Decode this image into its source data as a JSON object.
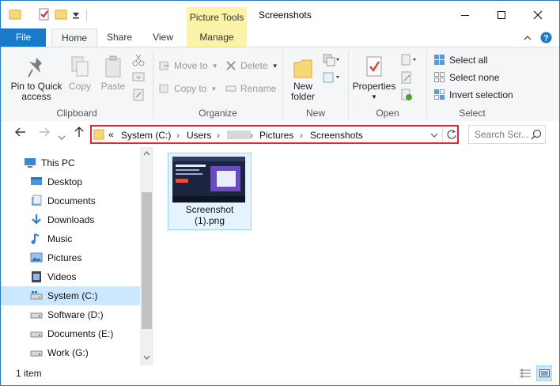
{
  "title_bar": {
    "contextual_tab_group": "Picture Tools",
    "window_title": "Screenshots"
  },
  "tabs": [
    {
      "label": "File"
    },
    {
      "label": "Home"
    },
    {
      "label": "Share"
    },
    {
      "label": "View"
    },
    {
      "label": "Manage"
    }
  ],
  "ribbon": {
    "clipboard": {
      "pin_label_1": "Pin to Quick",
      "pin_label_2": "access",
      "copy": "Copy",
      "paste": "Paste",
      "group": "Clipboard"
    },
    "organize": {
      "move_to": "Move to",
      "copy_to": "Copy to",
      "delete": "Delete",
      "rename": "Rename",
      "group": "Organize"
    },
    "new": {
      "new_folder_1": "New",
      "new_folder_2": "folder",
      "group": "New"
    },
    "open": {
      "properties": "Properties",
      "group": "Open"
    },
    "select": {
      "select_all": "Select all",
      "select_none": "Select none",
      "invert": "Invert selection",
      "group": "Select"
    }
  },
  "address": {
    "overflow": "«",
    "segments": [
      "System (C:)",
      "Users",
      "Pictures",
      "Screenshots"
    ],
    "search_placeholder": "Search Scr..."
  },
  "nav_pane": {
    "items": [
      {
        "label": "This PC",
        "icon": "pc-icon"
      },
      {
        "label": "Desktop",
        "icon": "desktop-icon"
      },
      {
        "label": "Documents",
        "icon": "documents-icon"
      },
      {
        "label": "Downloads",
        "icon": "downloads-icon"
      },
      {
        "label": "Music",
        "icon": "music-icon"
      },
      {
        "label": "Pictures",
        "icon": "pictures-icon"
      },
      {
        "label": "Videos",
        "icon": "videos-icon"
      },
      {
        "label": "System (C:)",
        "icon": "drive-c-icon",
        "selected": true
      },
      {
        "label": "Software (D:)",
        "icon": "drive-icon"
      },
      {
        "label": "Documents (E:)",
        "icon": "drive-icon"
      },
      {
        "label": "Work (G:)",
        "icon": "drive-icon"
      }
    ]
  },
  "files": [
    {
      "name_line1": "Screenshot",
      "name_line2": "(1).png"
    }
  ],
  "status": {
    "count": "1 item"
  },
  "colors": {
    "accent": "#1979ca",
    "contextual": "#fcf2a8",
    "highlight_border": "#e8242c",
    "selection": "#cce8ff"
  }
}
